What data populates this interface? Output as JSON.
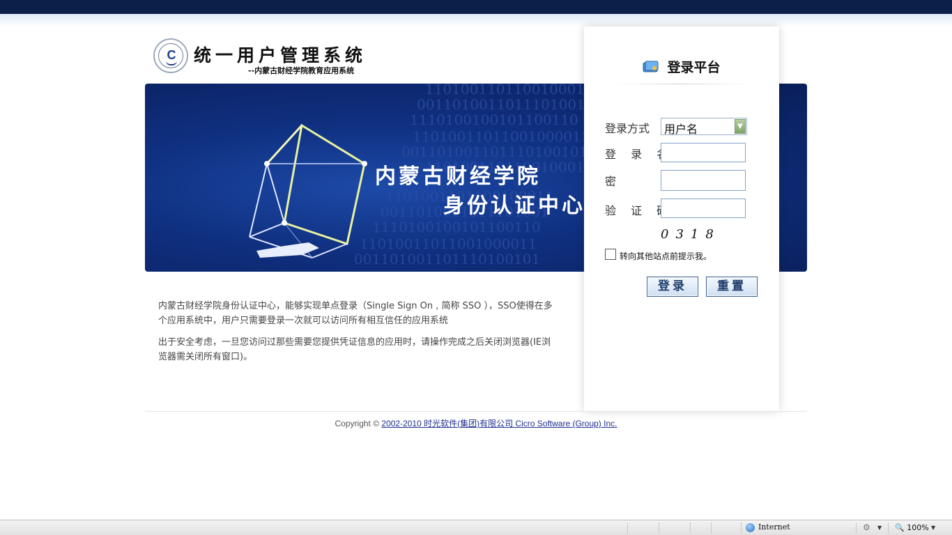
{
  "header": {
    "title": "统一用户管理系统",
    "subtitle": "--内蒙古财经学院教育应用系统"
  },
  "banner": {
    "line1": "内蒙古财经学院",
    "line2": "身份认证中心",
    "binary_rows": [
      "1101001101100100011",
      "0011010011011101001",
      "1110100100101100110",
      "11010011011001000011",
      "001101001101110100101",
      "1101001101100100010",
      "1101001101100100011",
      "0011010011011101001",
      "1110100100101100110",
      "11010011011001000011",
      "001101001101110100101"
    ]
  },
  "description": {
    "para1": "内蒙古财经学院身份认证中心，能够实现单点登录（Single Sign On , 简称 SSO ），SSO使得在多个应用系统中，用户只需要登录一次就可以访问所有相互信任的应用系统",
    "para2": "出于安全考虑，一旦您访问过那些需要您提供凭证信息的应用时，请操作完成之后关闭浏览器(IE浏览器需关闭所有窗口)。"
  },
  "login": {
    "title": "登录平台",
    "mode_label": "登录方式",
    "mode_value": "用户名",
    "username_label": "登 录 名:",
    "password_label": "密 码:",
    "captcha_label": "验 证 码:",
    "captcha_text": "0318",
    "remember_label": "转向其他站点前提示我。",
    "login_button": "登录",
    "reset_button": "重置"
  },
  "footer": {
    "prefix": "Copyright © ",
    "link": "2002-2010 时光软件(集团)有限公司 Cicro Software (Group) Inc."
  },
  "statusbar": {
    "zone": "Internet",
    "zoom": "100%"
  }
}
